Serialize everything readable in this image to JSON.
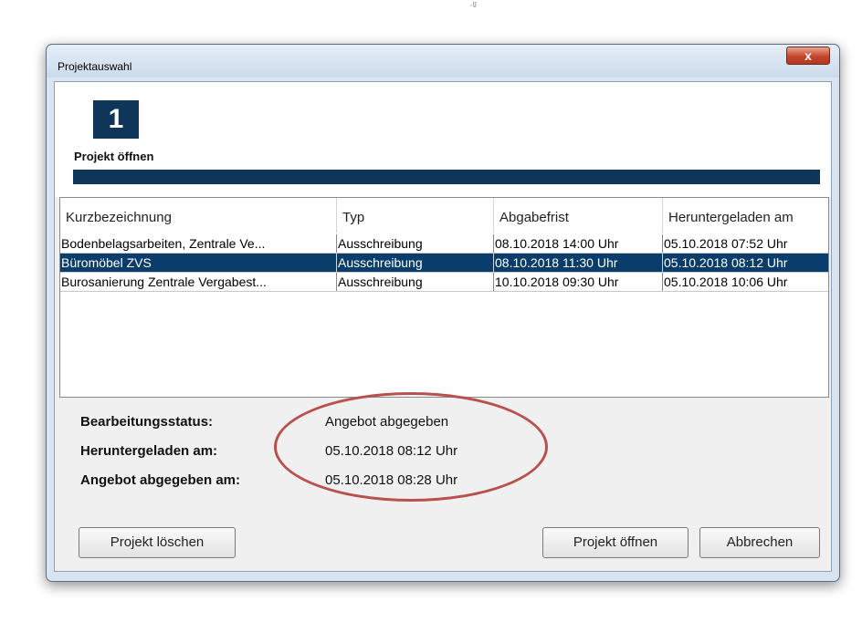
{
  "stray_mark": "·ᵍ",
  "window": {
    "title": "Projektauswahl",
    "close_glyph": "x"
  },
  "step": {
    "number": "1",
    "label": "Projekt öffnen"
  },
  "table": {
    "columns": [
      "Kurzbezeichnung",
      "Typ",
      "Abgabefrist",
      "Heruntergeladen am"
    ],
    "rows": [
      [
        "Bodenbelagsarbeiten, Zentrale Ve...",
        "Ausschreibung",
        "08.10.2018 14:00 Uhr",
        "05.10.2018 07:52 Uhr"
      ],
      [
        "Büromöbel ZVS",
        "Ausschreibung",
        "08.10.2018 11:30 Uhr",
        "05.10.2018 08:12 Uhr"
      ],
      [
        "Burosanierung Zentrale Vergabest...",
        "Ausschreibung",
        "10.10.2018 09:30 Uhr",
        "05.10.2018 10:06 Uhr"
      ]
    ],
    "selected_row": 1
  },
  "status": {
    "items": [
      {
        "label": "Bearbeitungsstatus:",
        "value": "Angebot abgegeben"
      },
      {
        "label": "Heruntergeladen am:",
        "value": "05.10.2018 08:12 Uhr"
      },
      {
        "label": "Angebot abgegeben am:",
        "value": "05.10.2018 08:28 Uhr"
      }
    ]
  },
  "buttons": {
    "delete": "Projekt löschen",
    "open": "Projekt öffnen",
    "cancel": "Abbrechen"
  },
  "colors": {
    "accent": "#0f3558",
    "selection": "#0b3d6b",
    "annotation": "#b8504c"
  }
}
